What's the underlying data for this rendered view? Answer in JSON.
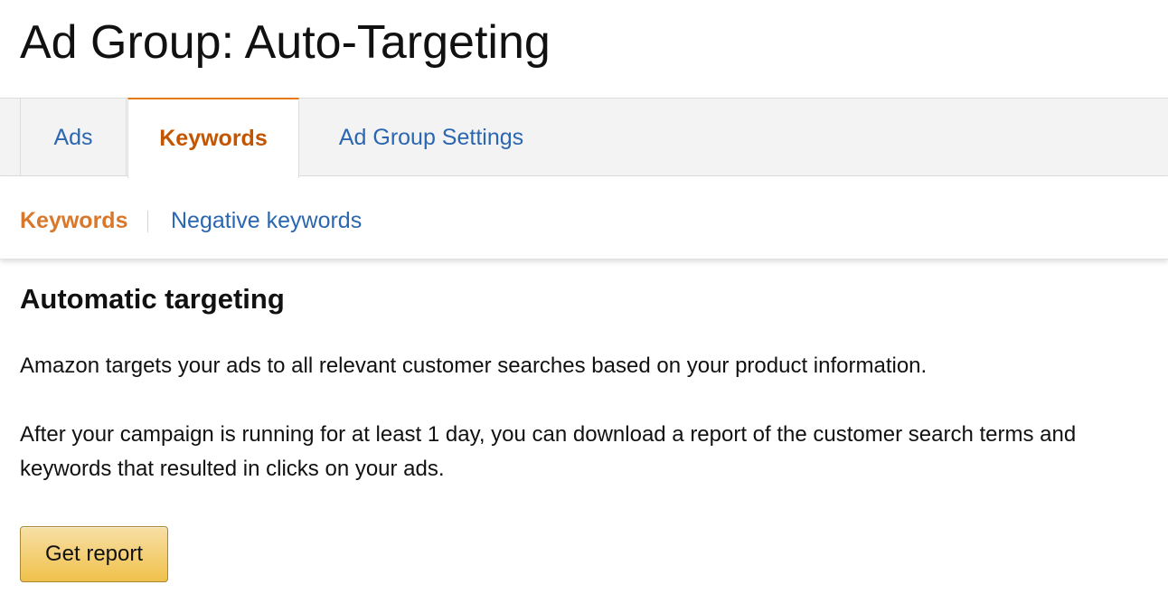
{
  "page": {
    "title": "Ad Group: Auto-Targeting"
  },
  "tabs": {
    "items": [
      {
        "label": "Ads",
        "active": false
      },
      {
        "label": "Keywords",
        "active": true
      },
      {
        "label": "Ad Group Settings",
        "active": false
      }
    ]
  },
  "subnav": {
    "active_label": "Keywords",
    "link_label": "Negative keywords"
  },
  "content": {
    "heading": "Automatic targeting",
    "paragraph_1": "Amazon targets your ads to all relevant customer searches based on your product information.",
    "paragraph_2": "After your campaign is running for at least 1 day, you can download a report of the customer search terms and keywords that resulted in clicks on your ads.",
    "button_label": "Get report"
  },
  "colors": {
    "link": "#2b66b0",
    "active_tab": "#c45500",
    "active_accent": "#e47911",
    "button_fill": "#f0c14b",
    "button_border": "#a88734"
  }
}
